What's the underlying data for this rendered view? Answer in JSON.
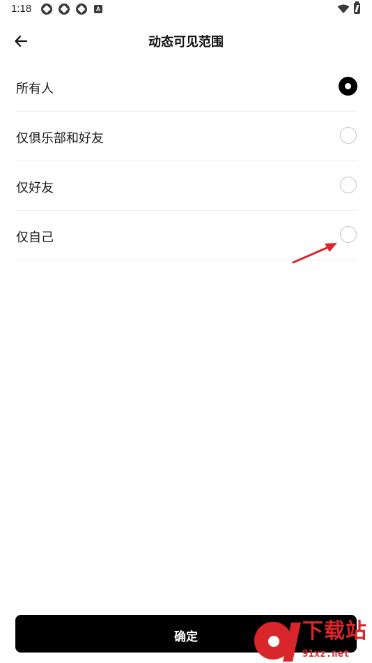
{
  "status_bar": {
    "time": "1:18",
    "notification_icons": [
      "sync-icon",
      "sync-icon",
      "sync-icon",
      "a-badge-icon"
    ],
    "a_badge": "A",
    "right_icons": [
      "wifi-icon",
      "battery-charging-icon"
    ]
  },
  "header": {
    "back_icon": "arrow-left-icon",
    "title": "动态可见范围"
  },
  "options": [
    {
      "label": "所有人",
      "selected": true
    },
    {
      "label": "仅俱乐部和好友",
      "selected": false
    },
    {
      "label": "仅好友",
      "selected": false
    },
    {
      "label": "仅自己",
      "selected": false
    }
  ],
  "annotation": {
    "type": "arrow",
    "color": "#d9262b",
    "points_to": "仅自己"
  },
  "confirm_button": {
    "label": "确定"
  },
  "watermark": {
    "title": "下载站",
    "domain": "91xz.net",
    "color": "#d9262b"
  },
  "colors": {
    "primary": "#000000",
    "background": "#ffffff",
    "divider": "#ececec",
    "radio_border": "#c4c4c4"
  }
}
